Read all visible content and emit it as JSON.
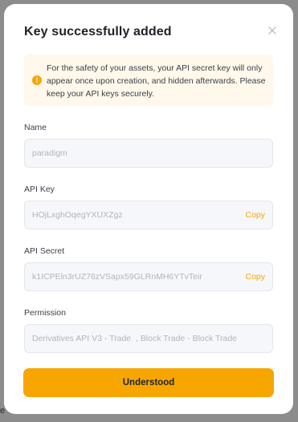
{
  "backdrop": {
    "fragment": "e"
  },
  "modal": {
    "title": "Key successfully added",
    "close_icon": "close-icon"
  },
  "notice": {
    "icon": "warning-icon",
    "icon_glyph": "!",
    "text": "For the safety of your assets, your API secret key will only appear once upon creation, and hidden afterwards. Please keep your API keys securely."
  },
  "fields": {
    "name": {
      "label": "Name",
      "value": "paradigm"
    },
    "api_key": {
      "label": "API Key",
      "value": "HOjLxghOqegYXUXZgz",
      "copy_label": "Copy"
    },
    "api_secret": {
      "label": "API Secret",
      "value": "k1ICPEln3rUZ76zVSapx59GLRnMH6YTvTeir",
      "copy_label": "Copy"
    },
    "permission": {
      "label": "Permission",
      "value": "Derivatives API V3 - Trade  , Block Trade - Block Trade"
    }
  },
  "actions": {
    "understood_label": "Understood"
  },
  "colors": {
    "accent": "#f7a600",
    "notice_bg": "#fff8eb",
    "field_bg": "#f5f7fa",
    "backdrop": "#8c8c8c"
  }
}
